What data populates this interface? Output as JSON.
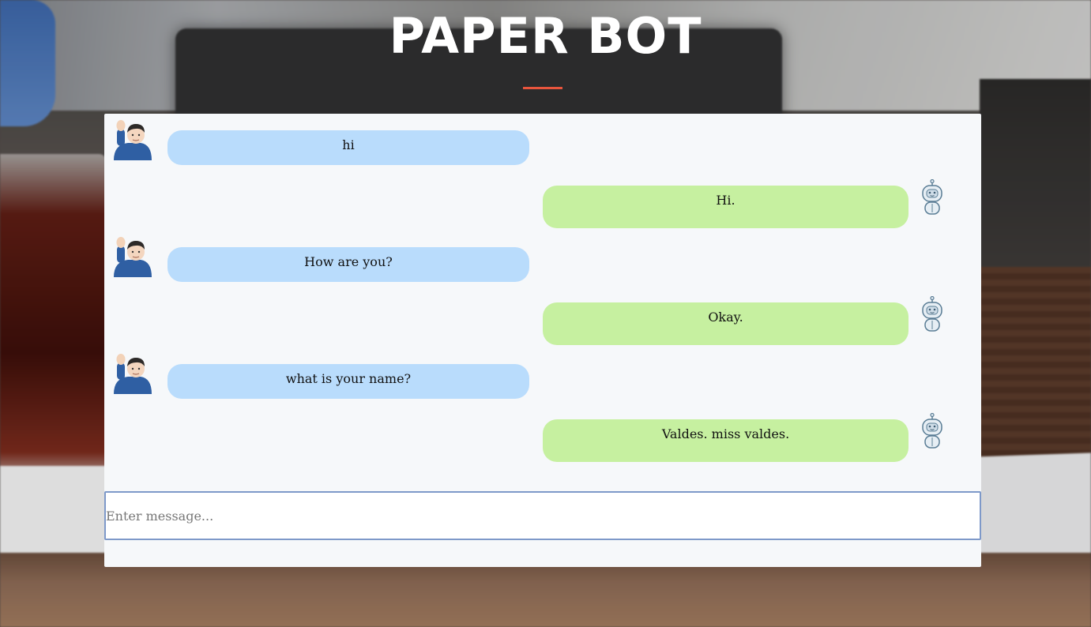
{
  "app": {
    "title": "PAPER BOT",
    "accent_color": "#e8553d"
  },
  "chat": {
    "messages": [
      {
        "sender": "user",
        "avatar_icon": "man-raising-hand-icon",
        "text": "hi",
        "bubble_color": "#b9dcfc"
      },
      {
        "sender": "bot",
        "avatar_icon": "robot-icon",
        "text": "Hi.",
        "bubble_color": "#c6f0a0"
      },
      {
        "sender": "user",
        "avatar_icon": "man-raising-hand-icon",
        "text": "How are you?",
        "bubble_color": "#b9dcfc"
      },
      {
        "sender": "bot",
        "avatar_icon": "robot-icon",
        "text": "Okay.",
        "bubble_color": "#c6f0a0"
      },
      {
        "sender": "user",
        "avatar_icon": "man-raising-hand-icon",
        "text": "what is your name?",
        "bubble_color": "#b9dcfc"
      },
      {
        "sender": "bot",
        "avatar_icon": "robot-icon",
        "text": "Valdes. miss valdes.",
        "bubble_color": "#c6f0a0"
      }
    ]
  },
  "composer": {
    "value": "",
    "placeholder": "Enter message..."
  }
}
